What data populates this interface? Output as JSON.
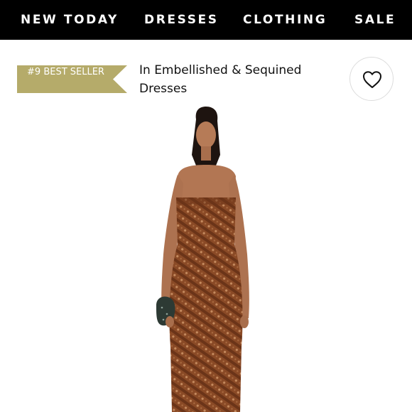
{
  "nav": {
    "items": [
      {
        "label": "NEW TODAY"
      },
      {
        "label": "DRESSES"
      },
      {
        "label": "CLOTHING"
      },
      {
        "label": "SALE"
      }
    ]
  },
  "badge": {
    "rank": "#9",
    "label": "BEST SELLER",
    "color": "#b5ab6a"
  },
  "category": {
    "title": "In Embellished & Sequined Dresses"
  },
  "favorite": {
    "icon": "heart-icon"
  },
  "product": {
    "image": "model-in-strapless-copper-sequin-gown",
    "dress_color": "#8a4a26"
  }
}
